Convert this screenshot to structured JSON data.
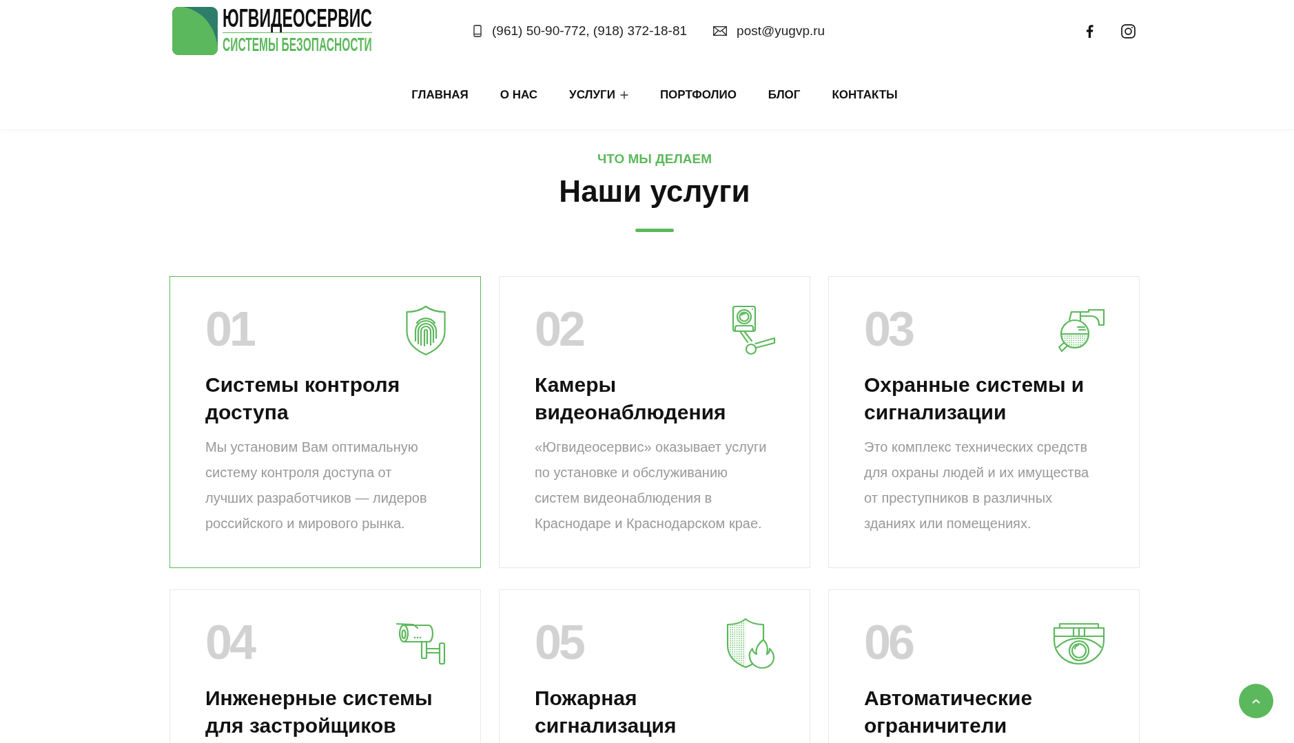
{
  "header": {
    "logo": {
      "title": "ЮГВИДЕОСЕРВИС",
      "subtitle": "СИСТЕМЫ БЕЗОПАСНОСТИ"
    },
    "phone": "(961) 50-90-772, (918) 372-18-81",
    "email": "post@yugvp.ru",
    "social": [
      {
        "kind": "facebook"
      },
      {
        "kind": "instagram"
      }
    ]
  },
  "nav": [
    {
      "label": "ГЛАВНАЯ",
      "submenu": false
    },
    {
      "label": "О НАС",
      "submenu": false
    },
    {
      "label": "УСЛУГИ",
      "submenu": true
    },
    {
      "label": "ПОРТФОЛИО",
      "submenu": false
    },
    {
      "label": "БЛОГ",
      "submenu": false
    },
    {
      "label": "КОНТАКТЫ",
      "submenu": false
    }
  ],
  "section": {
    "eyebrow": "ЧТО МЫ ДЕЛАЕМ",
    "title": "Наши услуги"
  },
  "services": [
    {
      "number": "01",
      "title": "Системы контроля доступа",
      "description": "Мы установим Вам оптимальную систему контроля доступа от лучших разработчиков — лидеров российского и мирового рынка.",
      "highlighted": true
    },
    {
      "number": "02",
      "title": "Камеры видеонаблюдения",
      "description": "«Югвидеосервис» оказывает услуги по установке и обслуживанию систем видеонаблюдения в Краснодаре и Краснодарском крае.",
      "highlighted": false
    },
    {
      "number": "03",
      "title": "Охранные системы и сигнализации",
      "description": "Это комплекс технических средств для охраны людей и их имущества от преступников в различных зданиях или помещениях.",
      "highlighted": false
    },
    {
      "number": "04",
      "title": "Инженерные системы для застройщиков",
      "highlighted": false
    },
    {
      "number": "05",
      "title": "Пожарная сигнализация",
      "highlighted": false
    },
    {
      "number": "06",
      "title": "Автоматические ограничители",
      "highlighted": false
    }
  ]
}
